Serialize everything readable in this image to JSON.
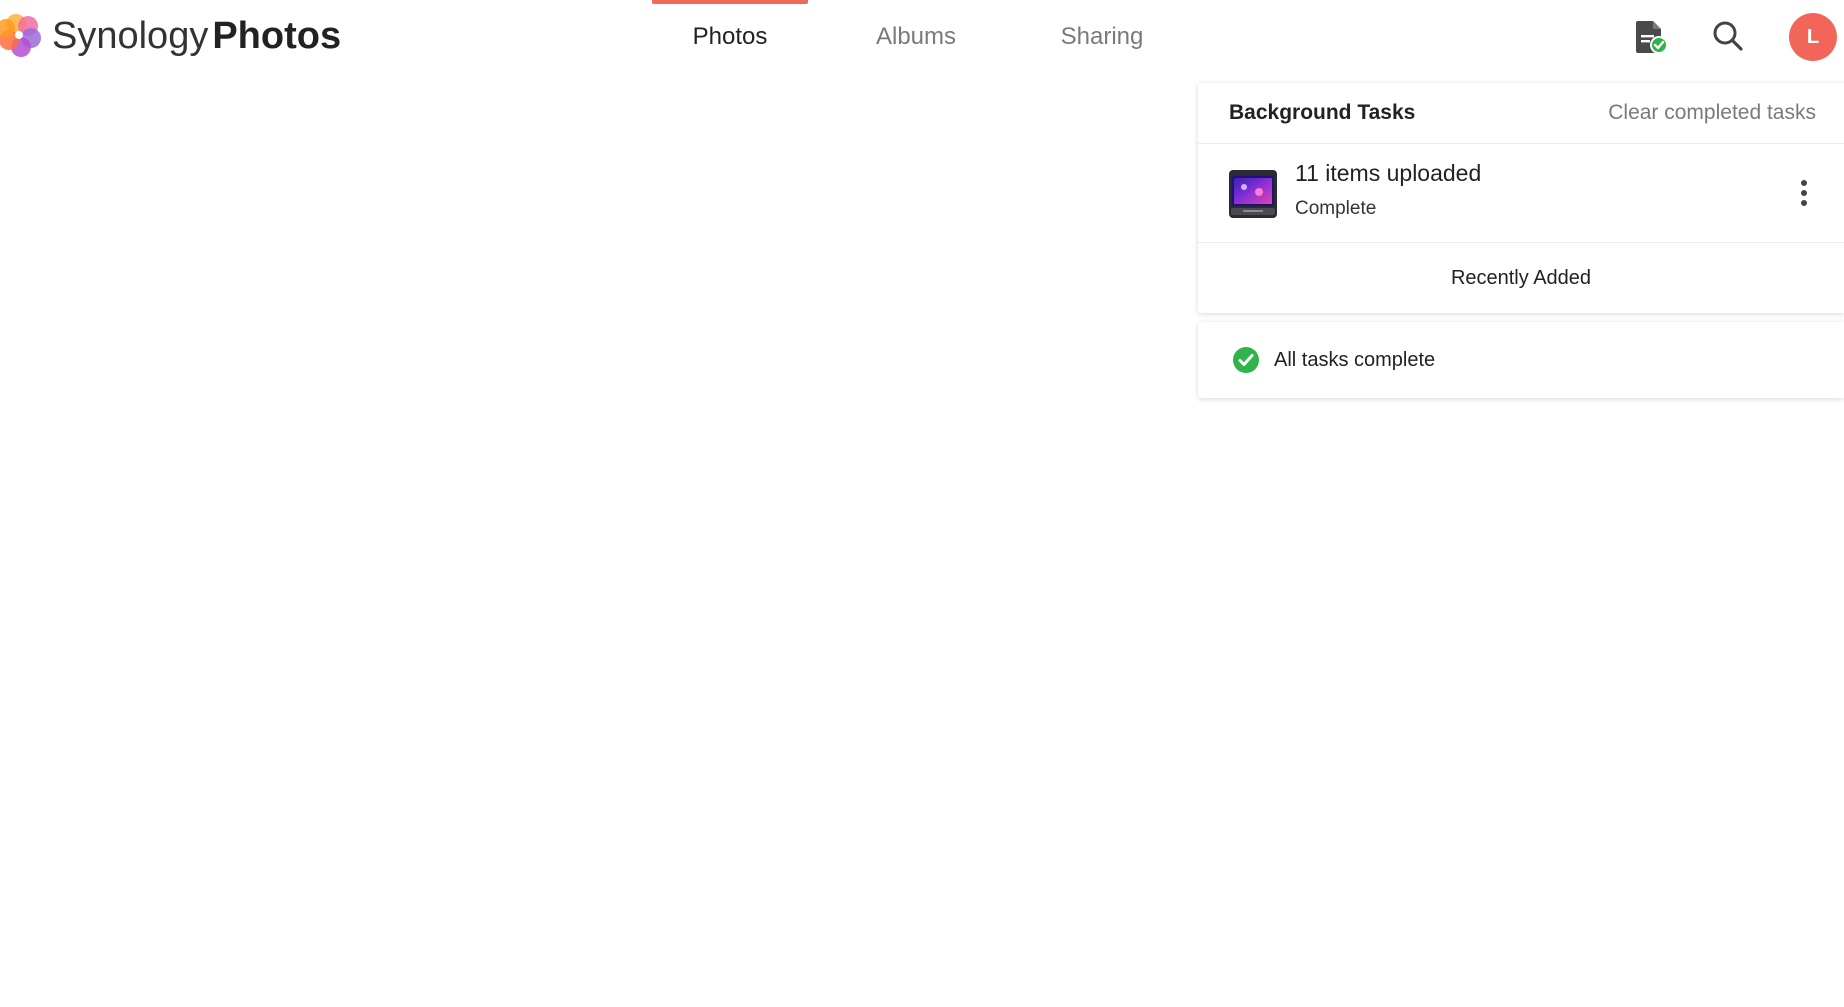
{
  "app": {
    "brand_light": "Synology",
    "brand_bold": "Photos"
  },
  "nav": {
    "tabs": [
      {
        "label": "Photos",
        "active": true
      },
      {
        "label": "Albums",
        "active": false
      },
      {
        "label": "Sharing",
        "active": false
      }
    ],
    "accent_color": "#ef6a5b"
  },
  "header": {
    "icons": [
      "task-document-check-icon",
      "search-icon"
    ],
    "avatar_initial": "L",
    "avatar_color": "#f2665a"
  },
  "background_tasks": {
    "title": "Background Tasks",
    "clear_label": "Clear completed tasks",
    "task": {
      "title": "11 items uploaded",
      "status": "Complete",
      "thumbnail": "upload-thumbnail",
      "menu_icon": "more-vertical-icon"
    },
    "recently_added_label": "Recently Added"
  },
  "status": {
    "text": "All tasks complete",
    "icon": "check-circle-icon",
    "color": "#2fb34a"
  }
}
